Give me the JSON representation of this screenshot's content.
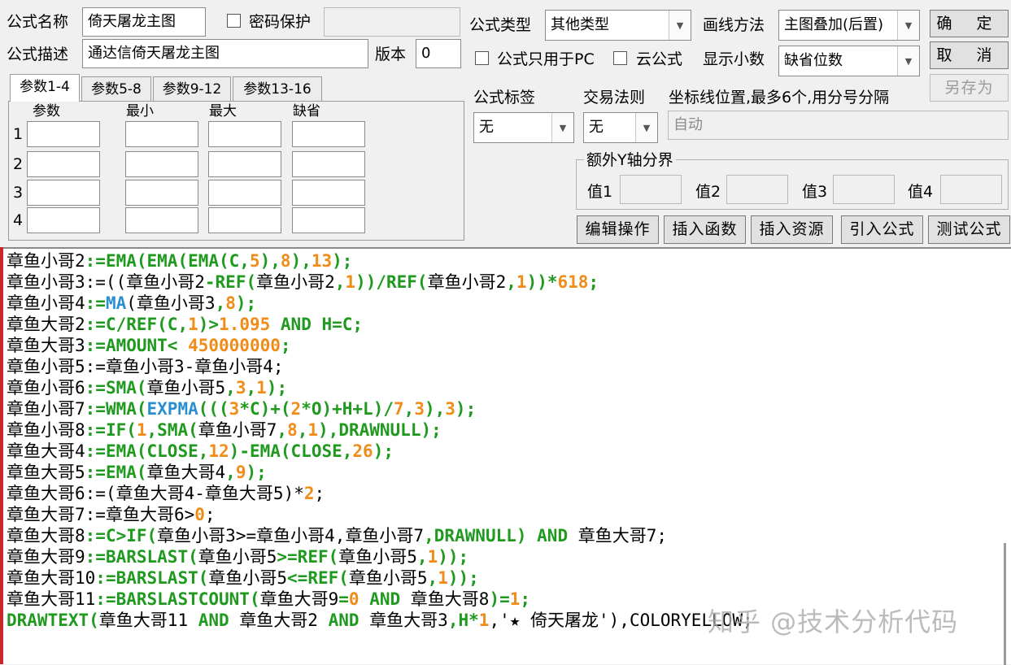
{
  "header": {
    "name_label": "公式名称",
    "name_value": "倚天屠龙主图",
    "password_label": "密码保护",
    "password_value": "",
    "desc_label": "公式描述",
    "desc_value": "通达信倚天屠龙主图",
    "version_label": "版本",
    "version_value": "0"
  },
  "options": {
    "type_label": "公式类型",
    "type_value": "其他类型",
    "draw_label": "画线方法",
    "draw_value": "主图叠加(后置)",
    "pc_only_label": "公式只用于PC",
    "cloud_label": "云公式",
    "decimal_label": "显示小数",
    "decimal_value": "缺省位数",
    "tag_label": "公式标签",
    "tag_value": "无",
    "rule_label": "交易法则",
    "rule_value": "无",
    "axis_label": "坐标线位置,最多6个,用分号分隔",
    "axis_value": "自动",
    "extra_y_label": "额外Y轴分界",
    "values": [
      {
        "label": "值1",
        "value": ""
      },
      {
        "label": "值2",
        "value": ""
      },
      {
        "label": "值3",
        "value": ""
      },
      {
        "label": "值4",
        "value": ""
      }
    ]
  },
  "buttons": {
    "ok": "确 定",
    "cancel": "取 消",
    "save_as": "另存为",
    "edit": "编辑操作",
    "insert_func": "插入函数",
    "insert_res": "插入资源",
    "import": "引入公式",
    "test": "测试公式"
  },
  "param_tabs": [
    "参数1-4",
    "参数5-8",
    "参数9-12",
    "参数13-16"
  ],
  "param_table": {
    "headers": [
      "参数",
      "最小",
      "最大",
      "缺省"
    ],
    "rows": [
      "1",
      "2",
      "3",
      "4"
    ]
  },
  "colors": {
    "name": "#000000",
    "keyword": "#1f9a1f",
    "function": "#2a8fd0",
    "number": "#f08c18",
    "operator": "#1f9a1f",
    "text": "#000000"
  },
  "code_lines": [
    [
      [
        "章鱼小哥2",
        ""
      ],
      [
        ":=EMA(EMA(EMA(C,",
        "k"
      ],
      [
        "5",
        "n"
      ],
      [
        "),",
        "k"
      ],
      [
        "8",
        "n"
      ],
      [
        "),",
        "k"
      ],
      [
        "13",
        "n"
      ],
      [
        ");",
        "k"
      ]
    ],
    [
      [
        "章鱼小哥3",
        ""
      ],
      [
        ":=((",
        ""
      ],
      [
        "章鱼小哥2",
        ""
      ],
      [
        "-REF(",
        "k"
      ],
      [
        "章鱼小哥2",
        ""
      ],
      [
        ",",
        "k"
      ],
      [
        "1",
        "n"
      ],
      [
        "))/REF(",
        "k"
      ],
      [
        "章鱼小哥2",
        ""
      ],
      [
        ",",
        "k"
      ],
      [
        "1",
        "n"
      ],
      [
        "))*",
        "k"
      ],
      [
        "618",
        "n"
      ],
      [
        ";",
        "k"
      ]
    ],
    [
      [
        "章鱼小哥4",
        ""
      ],
      [
        ":=",
        "k"
      ],
      [
        "MA",
        "f"
      ],
      [
        "(",
        ""
      ],
      [
        "章鱼小哥3",
        ""
      ],
      [
        ",",
        "k"
      ],
      [
        "8",
        "n"
      ],
      [
        ");",
        "k"
      ]
    ],
    [
      [
        "章鱼大哥2",
        ""
      ],
      [
        ":=C/REF(C,",
        "k"
      ],
      [
        "1",
        "n"
      ],
      [
        ")>",
        "k"
      ],
      [
        "1.095",
        "n"
      ],
      [
        " AND H=C;",
        "k"
      ]
    ],
    [
      [
        "章鱼大哥3",
        ""
      ],
      [
        ":=AMOUNT< ",
        "k"
      ],
      [
        "450000000",
        "n"
      ],
      [
        ";",
        "k"
      ]
    ],
    [
      [
        "章鱼小哥5",
        ""
      ],
      [
        ":=",
        ""
      ],
      [
        "章鱼小哥3",
        ""
      ],
      [
        "-",
        ""
      ],
      [
        "章鱼小哥4",
        ""
      ],
      [
        ";",
        ""
      ]
    ],
    [
      [
        "章鱼小哥6",
        ""
      ],
      [
        ":=SMA(",
        "k"
      ],
      [
        "章鱼小哥5",
        ""
      ],
      [
        ",",
        "k"
      ],
      [
        "3",
        "n"
      ],
      [
        ",",
        "k"
      ],
      [
        "1",
        "n"
      ],
      [
        ");",
        "k"
      ]
    ],
    [
      [
        "章鱼小哥7",
        ""
      ],
      [
        ":=WMA(",
        "k"
      ],
      [
        "EXPMA",
        "f"
      ],
      [
        "(((",
        "k"
      ],
      [
        "3",
        "n"
      ],
      [
        "*C)+(",
        "k"
      ],
      [
        "2",
        "n"
      ],
      [
        "*O)+H+L)/",
        "k"
      ],
      [
        "7",
        "n"
      ],
      [
        ",",
        "k"
      ],
      [
        "3",
        "n"
      ],
      [
        "),",
        "k"
      ],
      [
        "3",
        "n"
      ],
      [
        ");",
        "k"
      ]
    ],
    [
      [
        "章鱼小哥8",
        ""
      ],
      [
        ":=IF(",
        "k"
      ],
      [
        "1",
        "n"
      ],
      [
        ",SMA(",
        "k"
      ],
      [
        "章鱼小哥7",
        ""
      ],
      [
        ",",
        "k"
      ],
      [
        "8",
        "n"
      ],
      [
        ",",
        "k"
      ],
      [
        "1",
        "n"
      ],
      [
        "),DRAWNULL);",
        "k"
      ]
    ],
    [
      [
        "章鱼大哥4",
        ""
      ],
      [
        ":=EMA(CLOSE,",
        "k"
      ],
      [
        "12",
        "n"
      ],
      [
        ")-EMA(CLOSE,",
        "k"
      ],
      [
        "26",
        "n"
      ],
      [
        ");",
        "k"
      ]
    ],
    [
      [
        "章鱼大哥5",
        ""
      ],
      [
        ":=EMA(",
        "k"
      ],
      [
        "章鱼大哥4",
        ""
      ],
      [
        ",",
        "k"
      ],
      [
        "9",
        "n"
      ],
      [
        ");",
        "k"
      ]
    ],
    [
      [
        "章鱼大哥6",
        ""
      ],
      [
        ":=(",
        ""
      ],
      [
        "章鱼大哥4",
        ""
      ],
      [
        "-",
        ""
      ],
      [
        "章鱼大哥5",
        ""
      ],
      [
        ")*",
        ""
      ],
      [
        "2",
        "n"
      ],
      [
        ";",
        ""
      ]
    ],
    [
      [
        "章鱼大哥7",
        ""
      ],
      [
        ":=",
        ""
      ],
      [
        "章鱼大哥6",
        ""
      ],
      [
        ">",
        ""
      ],
      [
        "0",
        "n"
      ],
      [
        ";",
        ""
      ]
    ],
    [
      [
        "章鱼大哥8",
        ""
      ],
      [
        ":=C>IF(",
        "k"
      ],
      [
        "章鱼小哥3",
        ""
      ],
      [
        ">=",
        ""
      ],
      [
        "章鱼小哥4",
        ""
      ],
      [
        ",",
        ""
      ],
      [
        "章鱼小哥7",
        ""
      ],
      [
        ",DRAWNULL) AND ",
        "k"
      ],
      [
        "章鱼大哥7",
        ""
      ],
      [
        ";",
        ""
      ]
    ],
    [
      [
        "章鱼大哥9",
        ""
      ],
      [
        ":=BARSLAST(",
        "k"
      ],
      [
        "章鱼小哥5",
        ""
      ],
      [
        ">=REF(",
        "k"
      ],
      [
        "章鱼小哥5",
        ""
      ],
      [
        ",",
        "k"
      ],
      [
        "1",
        "n"
      ],
      [
        "));",
        "k"
      ]
    ],
    [
      [
        "章鱼大哥10",
        ""
      ],
      [
        ":=BARSLAST(",
        "k"
      ],
      [
        "章鱼小哥5",
        ""
      ],
      [
        "<=REF(",
        "k"
      ],
      [
        "章鱼小哥5",
        ""
      ],
      [
        ",",
        "k"
      ],
      [
        "1",
        "n"
      ],
      [
        "));",
        "k"
      ]
    ],
    [
      [
        "章鱼大哥11",
        ""
      ],
      [
        ":=BARSLASTCOUNT(",
        "k"
      ],
      [
        "章鱼大哥9",
        ""
      ],
      [
        "=",
        "k"
      ],
      [
        "0",
        "n"
      ],
      [
        " AND ",
        "k"
      ],
      [
        "章鱼大哥8",
        ""
      ],
      [
        ")=",
        "k"
      ],
      [
        "1",
        "n"
      ],
      [
        ";",
        "k"
      ]
    ],
    [
      [
        "DRAWTEXT(",
        "k"
      ],
      [
        "章鱼大哥11",
        ""
      ],
      [
        " AND ",
        "k"
      ],
      [
        "章鱼大哥2",
        ""
      ],
      [
        " AND ",
        "k"
      ],
      [
        "章鱼大哥3",
        ""
      ],
      [
        ",H*",
        "k"
      ],
      [
        "1",
        "n"
      ],
      [
        ",'★ 倚天屠龙'),COLORYELLOW;",
        ""
      ]
    ]
  ],
  "watermark": "知乎 @技术分析代码"
}
